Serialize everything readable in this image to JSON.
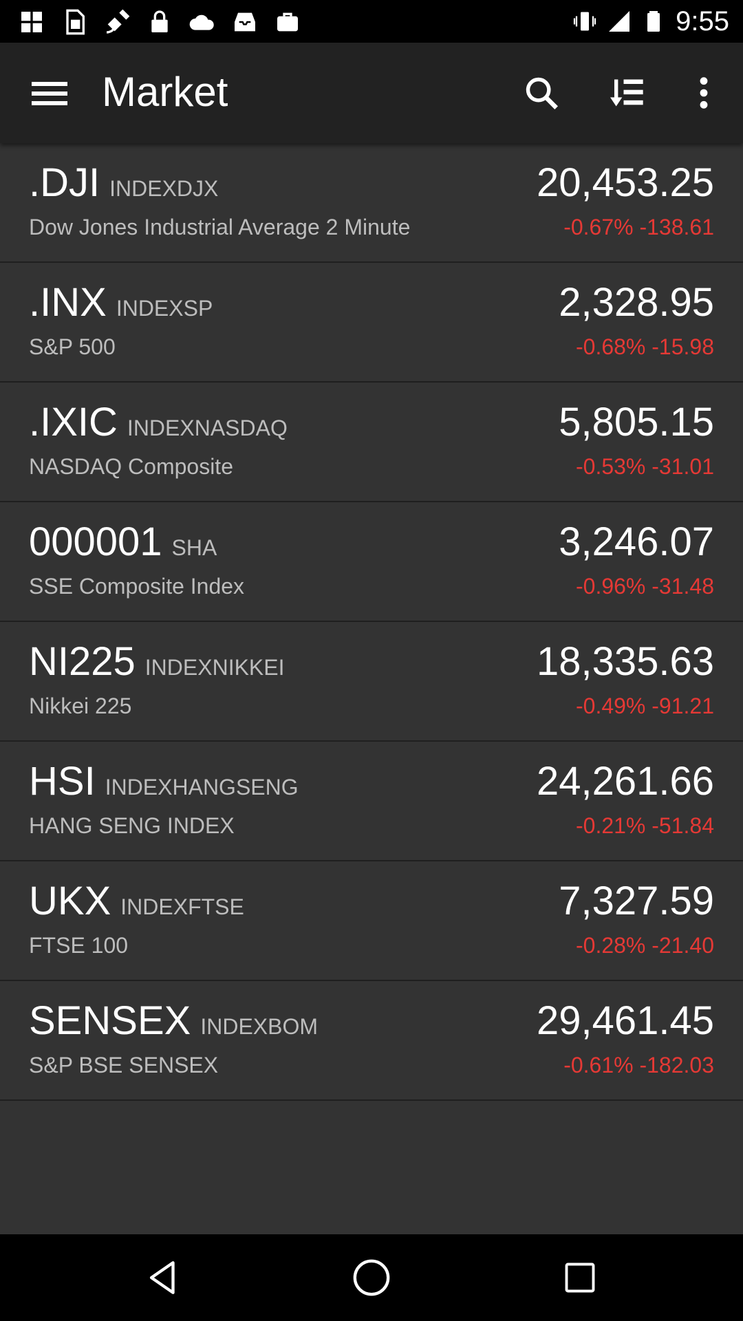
{
  "status_bar": {
    "time": "9:55",
    "left_icons": [
      "grid-icon",
      "sim-icon",
      "satellite-icon",
      "lock-icon",
      "cloud-icon",
      "inbox-icon",
      "briefcase-icon"
    ],
    "right_icons": [
      "vibrate-icon",
      "signal-icon",
      "battery-icon"
    ]
  },
  "app_bar": {
    "title": "Market",
    "menu_icon": "menu-icon",
    "actions": [
      "search-icon",
      "sort-icon",
      "more-icon"
    ]
  },
  "markets": [
    {
      "symbol": ".DJI",
      "exchange": "INDEXDJX",
      "name": "Dow Jones Industrial Average 2 Minute",
      "price": "20,453.25",
      "change": "-0.67% -138.61"
    },
    {
      "symbol": ".INX",
      "exchange": "INDEXSP",
      "name": "S&P 500",
      "price": "2,328.95",
      "change": "-0.68% -15.98"
    },
    {
      "symbol": ".IXIC",
      "exchange": "INDEXNASDAQ",
      "name": "NASDAQ Composite",
      "price": "5,805.15",
      "change": "-0.53% -31.01"
    },
    {
      "symbol": "000001",
      "exchange": "SHA",
      "name": "SSE Composite Index",
      "price": "3,246.07",
      "change": "-0.96% -31.48"
    },
    {
      "symbol": "NI225",
      "exchange": "INDEXNIKKEI",
      "name": "Nikkei 225",
      "price": "18,335.63",
      "change": "-0.49% -91.21"
    },
    {
      "symbol": "HSI",
      "exchange": "INDEXHANGSENG",
      "name": "HANG SENG INDEX",
      "price": "24,261.66",
      "change": "-0.21% -51.84"
    },
    {
      "symbol": "UKX",
      "exchange": "INDEXFTSE",
      "name": "FTSE 100",
      "price": "7,327.59",
      "change": "-0.28% -21.40"
    },
    {
      "symbol": "SENSEX",
      "exchange": "INDEXBOM",
      "name": "S&P BSE SENSEX",
      "price": "29,461.45",
      "change": "-0.61% -182.03"
    }
  ],
  "colors": {
    "negative": "#e53935",
    "background": "#333333",
    "app_bar": "#222222"
  },
  "nav_bar": [
    "back-icon",
    "home-icon",
    "recents-icon"
  ]
}
